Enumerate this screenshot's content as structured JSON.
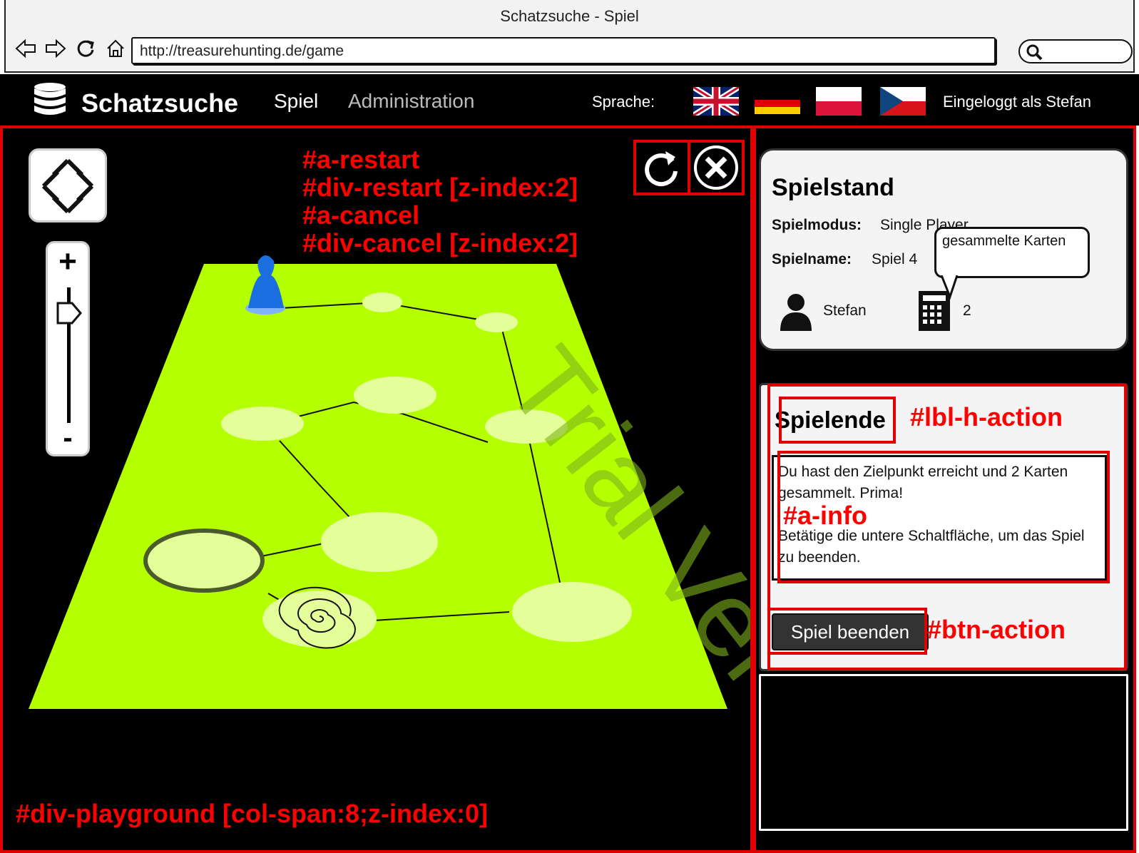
{
  "window": {
    "title": "Schatzsuche - Spiel"
  },
  "browser": {
    "url": "http://treasurehunting.de/game",
    "search_placeholder": ""
  },
  "app": {
    "brand": "Schatzsuche",
    "nav": [
      "Spiel",
      "Administration"
    ],
    "language_label": "Sprache:",
    "languages": [
      "en",
      "de",
      "pl",
      "cz"
    ],
    "user_status": "Eingeloggt als Stefan"
  },
  "annotations": {
    "top_lines": [
      "#a-restart",
      "#div-restart [z-index:2]",
      "#a-cancel",
      "#div-cancel [z-index:2]"
    ],
    "lbl_h_action": "#lbl-h-action",
    "a_info": "#a-info",
    "btn_action": "#btn-action",
    "playground": "#div-playground [col-span:8;z-index:0]"
  },
  "watermark": "Trial Version",
  "scoreboard": {
    "title": "Spielstand",
    "mode_label": "Spielmodus:",
    "mode_value": "Single Player",
    "name_label": "Spielname:",
    "name_value": "Spiel 4",
    "player": "Stefan",
    "cards_count": "2",
    "cards_tooltip": "gesammelte Karten"
  },
  "action": {
    "title": "Spielende",
    "info_line1": "Du hast den Zielpunkt erreicht und 2 Karten gesammelt. Prima!",
    "info_line2": "Betätige die untere Schaltfläche, um das Spiel zu beenden.",
    "button": "Spiel beenden"
  },
  "colors": {
    "accent": "#e00000",
    "board": "#b4ff00",
    "field": "#e4ff99",
    "piece": "#1a6ee0"
  }
}
